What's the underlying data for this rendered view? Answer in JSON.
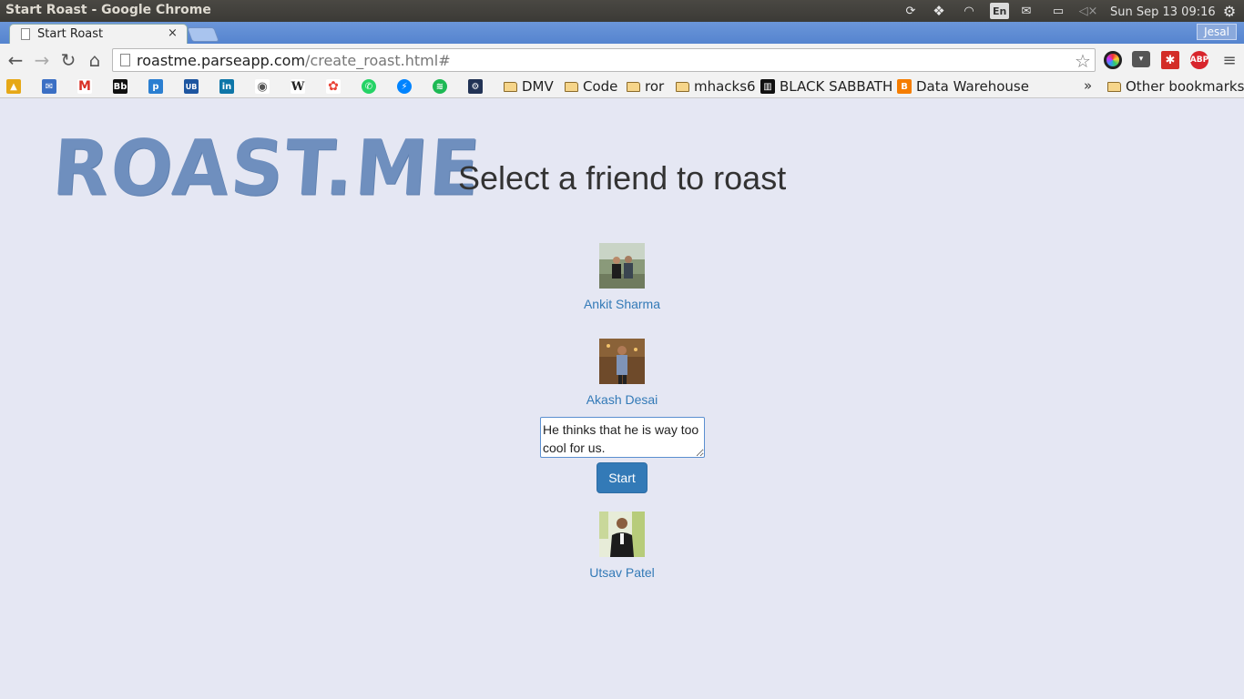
{
  "system_panel": {
    "window_title": "Start Roast - Google Chrome",
    "keyboard_layout": "En",
    "clock": "Sun Sep 13 09:16"
  },
  "browser": {
    "tab_title": "Start Roast",
    "tab_close": "×",
    "profile_name": "Jesal",
    "url_host": "roastme.parseapp.com",
    "url_path": "/create_roast.html#",
    "extensions": [
      {
        "name": "colorpicker-icon",
        "color": "#222222"
      },
      {
        "name": "pocket-icon",
        "color": "#555555"
      },
      {
        "name": "lastpass-icon",
        "color": "#d32d27"
      },
      {
        "name": "adblock-icon",
        "color": "#d8252c",
        "label": "ABP"
      }
    ]
  },
  "bookmarks": {
    "icon_items": [
      {
        "name": "bookmark-drive-icon",
        "color": "#e6a817",
        "glyph": "▲"
      },
      {
        "name": "bookmark-mail-icon",
        "color": "#3b6fc4",
        "glyph": "✉"
      },
      {
        "name": "bookmark-gmail-icon",
        "color": "#d93025",
        "glyph": "M"
      },
      {
        "name": "bookmark-blackboard-icon",
        "color": "#111111",
        "glyph": "Bb"
      },
      {
        "name": "bookmark-pearson-icon",
        "color": "#2b7fd1",
        "glyph": "p"
      },
      {
        "name": "bookmark-ub-icon",
        "color": "#1e56a0",
        "glyph": "UB"
      },
      {
        "name": "bookmark-linkedin-icon",
        "color": "#0e76a8",
        "glyph": "in"
      },
      {
        "name": "bookmark-github-icon",
        "color": "#555555",
        "glyph": "◉"
      },
      {
        "name": "bookmark-wikipedia-icon",
        "color": "#444444",
        "glyph": "W"
      },
      {
        "name": "bookmark-photos-icon",
        "color": "#e94235",
        "glyph": "✿"
      },
      {
        "name": "bookmark-whatsapp-icon",
        "color": "#25d366",
        "glyph": "✆"
      },
      {
        "name": "bookmark-messenger-icon",
        "color": "#0084ff",
        "glyph": "⚡"
      },
      {
        "name": "bookmark-spotify-icon",
        "color": "#1db954",
        "glyph": "≋"
      },
      {
        "name": "bookmark-tool-icon",
        "color": "#223355",
        "glyph": "⚙"
      }
    ],
    "folders": [
      {
        "label": "DMV"
      },
      {
        "label": "Code"
      },
      {
        "label": "ror"
      },
      {
        "label": "mhacks6"
      }
    ],
    "black_sabbath": "BLACK SABBATH",
    "data_warehouse": "Data Warehouse",
    "overflow": "»",
    "other_bookmarks": "Other bookmarks"
  },
  "page": {
    "logo_text": "ROAST.ME",
    "heading": "Select a friend to roast",
    "friends": [
      {
        "name": "Ankit Sharma"
      },
      {
        "name": "Akash Desai"
      },
      {
        "name": "Utsav Patel"
      }
    ],
    "roast_text": "He thinks that he is way too cool for us.",
    "start_label": "Start"
  }
}
